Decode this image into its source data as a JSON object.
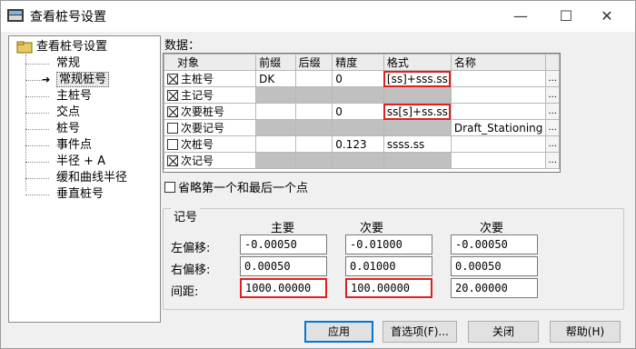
{
  "window": {
    "title": "查看桩号设置"
  },
  "titlebar": {
    "minimize": "—",
    "maximize": "☐",
    "close": "✕"
  },
  "tree": {
    "root": "查看桩号设置",
    "items": [
      "常规",
      "常规桩号",
      "主桩号",
      "交点",
      "桩号",
      "事件点",
      "半径 + A",
      "缓和曲线半径",
      "垂直桩号"
    ],
    "selected_index": 1
  },
  "data_section": {
    "label": "数据："
  },
  "grid": {
    "headers": [
      "对象",
      "前缀",
      "后缀",
      "精度",
      "格式",
      "名称"
    ],
    "rows": [
      {
        "checked": true,
        "object": "主桩号",
        "prefix": "DK",
        "suffix": "",
        "precision": "0",
        "format": "[ss]+sss.ss",
        "name": ""
      },
      {
        "checked": true,
        "object": "主记号",
        "prefix": "",
        "suffix": "",
        "precision": "",
        "format": "",
        "name": ""
      },
      {
        "checked": true,
        "object": "次要桩号",
        "prefix": "",
        "suffix": "",
        "precision": "0",
        "format": "ss[s]+ss.ss",
        "name": ""
      },
      {
        "checked": false,
        "object": "次要记号",
        "prefix": "",
        "suffix": "",
        "precision": "",
        "format": "",
        "name": "Draft_Stationing"
      },
      {
        "checked": false,
        "object": "次桩号",
        "prefix": "",
        "suffix": "",
        "precision": "0.123",
        "format": "ssss.ss",
        "name": ""
      },
      {
        "checked": true,
        "object": "次记号",
        "prefix": "",
        "suffix": "",
        "precision": "",
        "format": "",
        "name": ""
      }
    ],
    "ellipsis": "..."
  },
  "omit_checkbox": {
    "label": "省略第一个和最后一个点",
    "checked": false
  },
  "marks_group": {
    "title": "记号",
    "columns": [
      "主要",
      "次要",
      "次要"
    ],
    "rows": [
      {
        "label": "左偏移:",
        "values": [
          "-0.00050",
          "-0.01000",
          "-0.00050"
        ]
      },
      {
        "label": "右偏移:",
        "values": [
          "0.00050",
          "0.01000",
          "0.00050"
        ]
      },
      {
        "label": "间距:",
        "values": [
          "1000.00000",
          "100.00000",
          "20.00000"
        ]
      }
    ]
  },
  "buttons": {
    "apply": "应用",
    "options": "首选项(F)...",
    "close": "关闭",
    "help": "帮助(H)"
  },
  "colors": {
    "highlight": "#e02020",
    "gray_cell": "#c0c0c0",
    "default_button": "#0078d7"
  }
}
